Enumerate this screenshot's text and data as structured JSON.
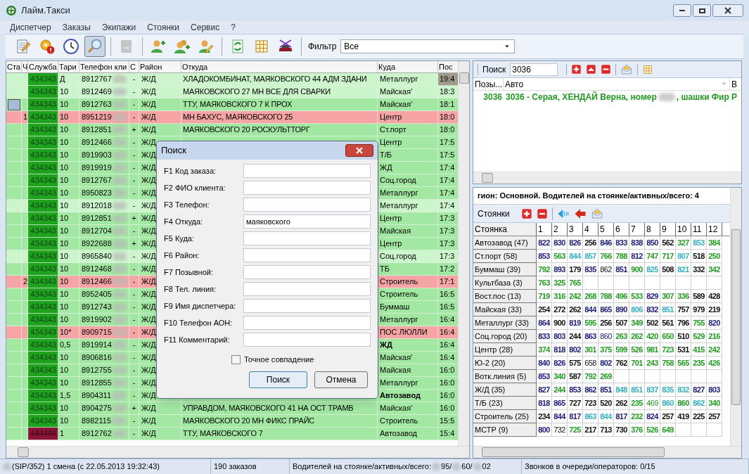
{
  "window": {
    "title": "Лайм.Такси"
  },
  "menu": [
    "Диспетчер",
    "Заказы",
    "Экипажи",
    "Стоянки",
    "Сервис",
    "?"
  ],
  "toolbar": {
    "buttons": [
      {
        "pressed": false,
        "disabled": false
      },
      {
        "pressed": false,
        "disabled": false
      },
      {
        "pressed": false,
        "disabled": false
      },
      {
        "pressed": true,
        "disabled": false
      },
      {
        "pressed": false,
        "disabled": true
      },
      {
        "pressed": false,
        "disabled": false
      },
      {
        "pressed": false,
        "disabled": false
      },
      {
        "pressed": false,
        "disabled": false
      },
      {
        "pressed": false,
        "disabled": false
      },
      {
        "pressed": false,
        "disabled": false
      },
      {
        "pressed": false,
        "disabled": false
      }
    ],
    "filter_label": "Фильтр",
    "filter_value": "Все"
  },
  "orders": {
    "columns": [
      "Ста",
      "Ч",
      "Служба",
      "Тари",
      "Телефон кли",
      "С",
      "Район",
      "Откуда",
      "Куда",
      "Пос"
    ],
    "rows": [
      {
        "kind": "light",
        "selected": true,
        "flagged": false,
        "service": "434343",
        "color": "#1fa31f",
        "tariff": "Д",
        "phone": "8912767",
        "sign": "-",
        "district": "Ж/Д",
        "from": "ХЛАДОКОМБИНАТ, МАЯКОВСКОГО 44  АДМ ЗДАНИ",
        "to": "Металлург",
        "to_bold": false,
        "time": "19:4"
      },
      {
        "kind": "light",
        "selected": false,
        "flagged": false,
        "service": "434343",
        "color": "#1fa31f",
        "tariff": "10",
        "phone": "8912469",
        "sign": "-",
        "district": "Ж/Д",
        "from": "МАЯКОВСКОГО 27  МН ВСЕ ДЛЯ СВАРКИ",
        "to": "Майская'",
        "to_bold": false,
        "time": "18:3"
      },
      {
        "kind": "normal",
        "selected": false,
        "flagged": true,
        "service": "434343",
        "color": "#1fa31f",
        "tariff": "10",
        "phone": "8912763",
        "sign": "-",
        "district": "Ж/Д",
        "from": "ТТУ, МАЯКОВСКОГО 7  К ПРОХ",
        "to": "Майская'",
        "to_bold": false,
        "time": "18:1"
      },
      {
        "kind": "alert",
        "selected": false,
        "flagged": false,
        "count": "1",
        "service": "434343",
        "color": "#1fa31f",
        "tariff": "10",
        "phone": "8951219",
        "sign": "-",
        "district": "Ж/Д",
        "from": "МН БАХУС, МАЯКОВСКОГО 25",
        "to": "Центр",
        "to_bold": false,
        "time": "18:0"
      },
      {
        "kind": "normal",
        "selected": false,
        "flagged": false,
        "service": "434343",
        "color": "#1fa31f",
        "tariff": "10",
        "phone": "8912851",
        "sign": "+",
        "district": "Ж/Д",
        "from": "МАЯКОВСКОГО 20 РОСКУЛЬТТОРГ",
        "to": "Ст.порт",
        "to_bold": false,
        "time": "18:0"
      },
      {
        "kind": "normal",
        "selected": false,
        "flagged": false,
        "service": "434343",
        "color": "#1fa31f",
        "tariff": "10",
        "phone": "8912466",
        "sign": "-",
        "district": "Ж/Д",
        "to": "Центр",
        "to_bold": false,
        "time": "17:5"
      },
      {
        "kind": "normal",
        "selected": false,
        "flagged": false,
        "service": "434343",
        "color": "#1fa31f",
        "tariff": "10",
        "phone": "8919903",
        "sign": "-",
        "district": "Ж/Д",
        "to": "Т/Б",
        "to_bold": false,
        "time": "17:5"
      },
      {
        "kind": "normal",
        "selected": false,
        "flagged": false,
        "service": "434343",
        "color": "#1fa31f",
        "tariff": "10",
        "phone": "8919919",
        "sign": "-",
        "district": "Ж/Д",
        "to": "ЖД",
        "to_bold": false,
        "time": "17:4"
      },
      {
        "kind": "normal",
        "selected": false,
        "flagged": false,
        "service": "434343",
        "color": "#1fa31f",
        "tariff": "10",
        "phone": "8912767",
        "sign": "-",
        "district": "Ж/Д",
        "to": "Соц.город",
        "to_bold": false,
        "time": "17:4"
      },
      {
        "kind": "normal",
        "selected": false,
        "flagged": false,
        "service": "434343",
        "color": "#1fa31f",
        "tariff": "10",
        "phone": "8950823",
        "sign": "-",
        "district": "Ж/Д",
        "to": "Металлург",
        "to_bold": false,
        "time": "17:4"
      },
      {
        "kind": "light",
        "selected": false,
        "flagged": false,
        "service": "434343",
        "color": "#1fa31f",
        "tariff": "10",
        "phone": "8912018",
        "sign": "-",
        "district": "Ж/Д",
        "to": "Металлург",
        "to_bold": false,
        "time": "17:4"
      },
      {
        "kind": "normal",
        "selected": false,
        "flagged": false,
        "service": "434343",
        "color": "#1fa31f",
        "tariff": "10",
        "phone": "8912851",
        "sign": "+",
        "district": "Ж/Д",
        "to": "Центр",
        "to_bold": false,
        "time": "17:3"
      },
      {
        "kind": "normal",
        "selected": false,
        "flagged": false,
        "service": "434343",
        "color": "#1fa31f",
        "tariff": "10",
        "phone": "8912704",
        "sign": "-",
        "district": "Ж/Д",
        "to": "Майская",
        "to_bold": false,
        "time": "17:3"
      },
      {
        "kind": "normal",
        "selected": false,
        "flagged": false,
        "service": "434343",
        "color": "#1fa31f",
        "tariff": "10",
        "phone": "8922688",
        "sign": "+",
        "district": "Ж/Д",
        "to": "Центр",
        "to_bold": false,
        "time": "17:3"
      },
      {
        "kind": "light",
        "selected": false,
        "flagged": false,
        "service": "434343",
        "color": "#1fa31f",
        "tariff": "10",
        "phone": "8965840",
        "sign": "-",
        "district": "Ж/Д",
        "to": "Соц.город",
        "to_bold": false,
        "time": "17:3"
      },
      {
        "kind": "normal",
        "selected": false,
        "flagged": false,
        "service": "434343",
        "color": "#1fa31f",
        "tariff": "10",
        "phone": "8912468",
        "sign": "-",
        "district": "Ж/Д",
        "to": "ТБ",
        "to_bold": false,
        "time": "17:2"
      },
      {
        "kind": "alert",
        "selected": false,
        "flagged": false,
        "count": "2",
        "service": "434343",
        "color": "#1fa31f",
        "tariff": "10",
        "phone": "8912466",
        "sign": "-",
        "district": "Ж/Д",
        "to": "Строитель",
        "to_bold": false,
        "time": "17:1"
      },
      {
        "kind": "normal",
        "selected": false,
        "flagged": false,
        "service": "434343",
        "color": "#1fa31f",
        "tariff": "10",
        "phone": "8952405",
        "sign": "-",
        "district": "Ж/Д",
        "to": "Строитель",
        "to_bold": false,
        "time": "16:5"
      },
      {
        "kind": "normal",
        "selected": false,
        "flagged": false,
        "service": "434343",
        "color": "#1fa31f",
        "tariff": "10",
        "phone": "8912743",
        "sign": "-",
        "district": "Ж/Д",
        "to": "Буммаш",
        "to_bold": false,
        "time": "16:5"
      },
      {
        "kind": "normal",
        "selected": false,
        "flagged": false,
        "service": "434343",
        "color": "#1fa31f",
        "tariff": "10",
        "phone": "8919902",
        "sign": "-",
        "district": "Ж/Д",
        "to": "Металлург",
        "to_bold": false,
        "time": "16:4"
      },
      {
        "kind": "alert",
        "selected": false,
        "flagged": false,
        "service": "434343",
        "color": "#1fa31f",
        "tariff": "10*",
        "phone": "8909715",
        "sign": "-",
        "district": "Ж/Д",
        "to": "ПОС ЛЮЛЛИ",
        "to_bold": false,
        "time": "16:4"
      },
      {
        "kind": "normal",
        "selected": false,
        "flagged": false,
        "service": "434343",
        "color": "#1fa31f",
        "tariff": "0,5",
        "phone": "8919914",
        "sign": "-",
        "district": "Ж/Д",
        "to": "ЖД",
        "to_bold": true,
        "time": "16:4"
      },
      {
        "kind": "normal",
        "selected": false,
        "flagged": false,
        "service": "434343",
        "color": "#1fa31f",
        "tariff": "10",
        "phone": "8906816",
        "sign": "-",
        "district": "Ж/Д",
        "to": "Майская'",
        "to_bold": false,
        "time": "16:4"
      },
      {
        "kind": "normal",
        "selected": false,
        "flagged": false,
        "service": "434343",
        "color": "#1fa31f",
        "tariff": "10",
        "phone": "8912755",
        "sign": "-",
        "district": "Ж/Д",
        "to": "Майская",
        "to_bold": false,
        "time": "16:0"
      },
      {
        "kind": "normal",
        "selected": false,
        "flagged": false,
        "service": "434343",
        "color": "#1fa31f",
        "tariff": "10",
        "phone": "8912855",
        "sign": "-",
        "district": "Ж/Д",
        "to": "Металлург",
        "to_bold": false,
        "time": "16:0"
      },
      {
        "kind": "normal",
        "selected": false,
        "flagged": false,
        "service": "434343",
        "color": "#1fa31f",
        "tariff": "1,5",
        "phone": "8904311",
        "sign": "-",
        "district": "Ж/Д",
        "to": "Автозавод",
        "to_bold": true,
        "time": "16:0"
      },
      {
        "kind": "normal",
        "selected": false,
        "flagged": false,
        "service": "434343",
        "color": "#1fa31f",
        "tariff": "10",
        "phone": "8904275",
        "sign": "+",
        "district": "Ж/Д",
        "from": "УПРАВДОМ, МАЯКОВСКОГО 41 НА ОСТ ТРАМВ",
        "to": "Майская'",
        "to_bold": false,
        "time": "16:0"
      },
      {
        "kind": "normal",
        "selected": false,
        "flagged": false,
        "service": "434343",
        "color": "#1fa31f",
        "tariff": "10",
        "phone": "8982115",
        "sign": "-",
        "district": "Ж/Д",
        "from": "МАЯКОВСКОГО 20 МН ФИКС ПРАЙС",
        "to": "Строитель",
        "to_bold": false,
        "time": "15:5"
      },
      {
        "kind": "normal",
        "selected": false,
        "flagged": false,
        "service": "444444",
        "color": "#8a1539",
        "tariff": "1",
        "phone": "8912762",
        "sign": "-",
        "district": "Ж/Д",
        "from": "ТТУ, МАЯКОВСКОГО 7",
        "to": "Автозавод",
        "to_bold": false,
        "time": "15:4"
      }
    ]
  },
  "crew_search": {
    "label": "Поиск",
    "value": "3036",
    "columns": [
      "Позы...",
      "Авто",
      "В"
    ],
    "rows": [
      {
        "callsign": "3036",
        "auto_before": "3036 - Серая, ХЕНДАЙ Верна, номер",
        "auto_after": ", шашки Фир",
        "column_3": "Р"
      }
    ]
  },
  "stops": {
    "header": "гион: Основной. Водителей на стоянке/активных/всего: 4",
    "toolbar_label": "Стоянки",
    "corner": "Стоянка",
    "columns": [
      "1",
      "2",
      "3",
      "4",
      "5",
      "6",
      "7",
      "8",
      "9",
      "10",
      "11",
      "12"
    ],
    "rows": [
      {
        "name": "Автозавод (47)",
        "cells": [
          {
            "text": "822",
            "color": "#1c1c78",
            "bold": true
          },
          {
            "text": "830",
            "color": "#1c1c78",
            "bold": true
          },
          {
            "text": "826",
            "color": "#1c1c78",
            "bold": true
          },
          {
            "text": "256",
            "color": "#111111",
            "bold": true
          },
          {
            "text": "846",
            "color": "#1c1c78",
            "bold": true
          },
          {
            "text": "833",
            "color": "#1c1c78",
            "bold": true
          },
          {
            "text": "838",
            "color": "#1c1c78",
            "bold": true
          },
          {
            "text": "850",
            "color": "#1c1c78",
            "bold": true
          },
          {
            "text": "562",
            "color": "#111111",
            "bold": true
          },
          {
            "text": "327",
            "color": "#239a23",
            "bold": true
          },
          {
            "text": "853",
            "color": "#38b0c0",
            "bold": true
          },
          {
            "text": "384",
            "color": "#239a23",
            "bold": true
          }
        ]
      },
      {
        "name": "Ст.порт (58)",
        "cells": [
          {
            "text": "853",
            "color": "#1c1c78",
            "bold": true
          },
          {
            "text": "563",
            "color": "#239a23",
            "bold": true
          },
          {
            "text": "844",
            "color": "#38b0c0",
            "bold": true
          },
          {
            "text": "857",
            "color": "#38b0c0",
            "bold": true
          },
          {
            "text": "766",
            "color": "#239a23",
            "bold": true
          },
          {
            "text": "788",
            "color": "#239a23",
            "bold": true
          },
          {
            "text": "812",
            "color": "#1c1c78",
            "bold": true
          },
          {
            "text": "747",
            "color": "#239a23",
            "bold": true
          },
          {
            "text": "717",
            "color": "#239a23",
            "bold": true
          },
          {
            "text": "807",
            "color": "#38b0c0",
            "bold": true
          },
          {
            "text": "518",
            "color": "#111111",
            "bold": true
          },
          {
            "text": "250",
            "color": "#239a23",
            "bold": true
          }
        ]
      },
      {
        "name": "Буммаш (39)",
        "cells": [
          {
            "text": "792",
            "color": "#239a23",
            "bold": true
          },
          {
            "text": "893",
            "color": "#1c1c78",
            "bold": true
          },
          {
            "text": "179",
            "color": "#111111",
            "bold": true
          },
          {
            "text": "835",
            "color": "#1c1c78",
            "bold": true
          },
          {
            "text": "862",
            "color": "#111111",
            "bold": false
          },
          {
            "text": "851",
            "color": "#1c1c78",
            "bold": true
          },
          {
            "text": "900",
            "color": "#239a23",
            "bold": true
          },
          {
            "text": "825",
            "color": "#38b0c0",
            "bold": true
          },
          {
            "text": "508",
            "color": "#111111",
            "bold": true
          },
          {
            "text": "821",
            "color": "#38b0c0",
            "bold": true
          },
          {
            "text": "332",
            "color": "#111111",
            "bold": true
          },
          {
            "text": "342",
            "color": "#239a23",
            "bold": true
          }
        ]
      },
      {
        "name": "Культбаза (3)",
        "cells": [
          {
            "text": "763",
            "color": "#239a23",
            "bold": true
          },
          {
            "text": "325",
            "color": "#239a23",
            "bold": true
          },
          {
            "text": "765",
            "color": "#239a23",
            "bold": true
          }
        ]
      },
      {
        "name": "Вост.пос (13)",
        "cells": [
          {
            "text": "719",
            "color": "#239a23",
            "bold": true
          },
          {
            "text": "316",
            "color": "#239a23",
            "bold": true
          },
          {
            "text": "242",
            "color": "#239a23",
            "bold": true
          },
          {
            "text": "268",
            "color": "#239a23",
            "bold": true
          },
          {
            "text": "788",
            "color": "#239a23",
            "bold": true
          },
          {
            "text": "496",
            "color": "#239a23",
            "bold": true
          },
          {
            "text": "533",
            "color": "#239a23",
            "bold": true
          },
          {
            "text": "829",
            "color": "#1c1c78",
            "bold": true
          },
          {
            "text": "307",
            "color": "#239a23",
            "bold": true
          },
          {
            "text": "336",
            "color": "#239a23",
            "bold": true
          },
          {
            "text": "589",
            "color": "#111111",
            "bold": true
          },
          {
            "text": "428",
            "color": "#111111",
            "bold": true
          }
        ]
      },
      {
        "name": "Майская (33)",
        "cells": [
          {
            "text": "254",
            "color": "#111111",
            "bold": true
          },
          {
            "text": "272",
            "color": "#111111",
            "bold": true
          },
          {
            "text": "262",
            "color": "#111111",
            "bold": true
          },
          {
            "text": "844",
            "color": "#1c1c78",
            "bold": true
          },
          {
            "text": "865",
            "color": "#1c1c78",
            "bold": true
          },
          {
            "text": "890",
            "color": "#1c1c78",
            "bold": true
          },
          {
            "text": "806",
            "color": "#38b0c0",
            "bold": true
          },
          {
            "text": "832",
            "color": "#1c1c78",
            "bold": true
          },
          {
            "text": "851",
            "color": "#38b0c0",
            "bold": true
          },
          {
            "text": "757",
            "color": "#111111",
            "bold": true
          },
          {
            "text": "979",
            "color": "#111111",
            "bold": true
          },
          {
            "text": "219",
            "color": "#111111",
            "bold": true
          }
        ]
      },
      {
        "name": "Металлург (33)",
        "cells": [
          {
            "text": "864",
            "color": "#1c1c78",
            "bold": true
          },
          {
            "text": "900",
            "color": "#111111",
            "bold": true
          },
          {
            "text": "819",
            "color": "#1c1c78",
            "bold": true
          },
          {
            "text": "595",
            "color": "#239a23",
            "bold": true
          },
          {
            "text": "256",
            "color": "#111111",
            "bold": true
          },
          {
            "text": "507",
            "color": "#111111",
            "bold": true
          },
          {
            "text": "349",
            "color": "#239a23",
            "bold": true
          },
          {
            "text": "502",
            "color": "#111111",
            "bold": true
          },
          {
            "text": "561",
            "color": "#111111",
            "bold": true
          },
          {
            "text": "796",
            "color": "#111111",
            "bold": true
          },
          {
            "text": "755",
            "color": "#239a23",
            "bold": true
          },
          {
            "text": "820",
            "color": "#1c1c78",
            "bold": true
          }
        ]
      },
      {
        "name": "Соц.город (20)",
        "cells": [
          {
            "text": "833",
            "color": "#1c1c78",
            "bold": true
          },
          {
            "text": "803",
            "color": "#1c1c78",
            "bold": true
          },
          {
            "text": "244",
            "color": "#111111",
            "bold": true
          },
          {
            "text": "863",
            "color": "#1c1c78",
            "bold": true
          },
          {
            "text": "860",
            "color": "#1c1c78",
            "bold": false
          },
          {
            "text": "263",
            "color": "#239a23",
            "bold": true
          },
          {
            "text": "262",
            "color": "#239a23",
            "bold": true
          },
          {
            "text": "420",
            "color": "#239a23",
            "bold": true
          },
          {
            "text": "650",
            "color": "#239a23",
            "bold": true
          },
          {
            "text": "510",
            "color": "#111111",
            "bold": true
          },
          {
            "text": "529",
            "color": "#239a23",
            "bold": true
          },
          {
            "text": "216",
            "color": "#239a23",
            "bold": true
          }
        ]
      },
      {
        "name": "Центр (28)",
        "cells": [
          {
            "text": "374",
            "color": "#239a23",
            "bold": true
          },
          {
            "text": "818",
            "color": "#1c1c78",
            "bold": true
          },
          {
            "text": "802",
            "color": "#1c1c78",
            "bold": true
          },
          {
            "text": "301",
            "color": "#239a23",
            "bold": true
          },
          {
            "text": "375",
            "color": "#239a23",
            "bold": true
          },
          {
            "text": "599",
            "color": "#239a23",
            "bold": true
          },
          {
            "text": "526",
            "color": "#239a23",
            "bold": true
          },
          {
            "text": "981",
            "color": "#239a23",
            "bold": true
          },
          {
            "text": "723",
            "color": "#239a23",
            "bold": true
          },
          {
            "text": "531",
            "color": "#111111",
            "bold": true
          },
          {
            "text": "415",
            "color": "#239a23",
            "bold": true
          },
          {
            "text": "242",
            "color": "#239a23",
            "bold": true
          }
        ]
      },
      {
        "name": "Ю-2 (20)",
        "cells": [
          {
            "text": "840",
            "color": "#1c1c78",
            "bold": true
          },
          {
            "text": "826",
            "color": "#1c1c78",
            "bold": true
          },
          {
            "text": "575",
            "color": "#111111",
            "bold": true
          },
          {
            "text": "658",
            "color": "#111111",
            "bold": false
          },
          {
            "text": "802",
            "color": "#1c1c78",
            "bold": true
          },
          {
            "text": "762",
            "color": "#111111",
            "bold": true
          },
          {
            "text": "701",
            "color": "#239a23",
            "bold": true
          },
          {
            "text": "243",
            "color": "#239a23",
            "bold": true
          },
          {
            "text": "758",
            "color": "#239a23",
            "bold": true
          },
          {
            "text": "565",
            "color": "#239a23",
            "bold": true
          },
          {
            "text": "235",
            "color": "#239a23",
            "bold": true
          },
          {
            "text": "426",
            "color": "#239a23",
            "bold": true
          }
        ]
      },
      {
        "name": "Вотк.линия (5)",
        "cells": [
          {
            "text": "853",
            "color": "#1c1c78",
            "bold": true
          },
          {
            "text": "340",
            "color": "#239a23",
            "bold": true
          },
          {
            "text": "587",
            "color": "#111111",
            "bold": true
          },
          {
            "text": "792",
            "color": "#239a23",
            "bold": true
          },
          {
            "text": "269",
            "color": "#239a23",
            "bold": true
          }
        ]
      },
      {
        "name": "Ж/Д (35)",
        "cells": [
          {
            "text": "827",
            "color": "#1c1c78",
            "bold": true
          },
          {
            "text": "244",
            "color": "#239a23",
            "bold": true
          },
          {
            "text": "853",
            "color": "#1c1c78",
            "bold": true
          },
          {
            "text": "862",
            "color": "#1c1c78",
            "bold": true
          },
          {
            "text": "851",
            "color": "#1c1c78",
            "bold": true
          },
          {
            "text": "848",
            "color": "#38b0c0",
            "bold": true
          },
          {
            "text": "851",
            "color": "#38b0c0",
            "bold": true
          },
          {
            "text": "837",
            "color": "#38b0c0",
            "bold": true
          },
          {
            "text": "835",
            "color": "#38b0c0",
            "bold": true
          },
          {
            "text": "832",
            "color": "#38b0c0",
            "bold": true
          },
          {
            "text": "827",
            "color": "#1c1c78",
            "bold": true
          },
          {
            "text": "803",
            "color": "#1c1c78",
            "bold": true
          }
        ]
      },
      {
        "name": "Т/Б (23)",
        "cells": [
          {
            "text": "818",
            "color": "#1c1c78",
            "bold": true
          },
          {
            "text": "865",
            "color": "#1c1c78",
            "bold": true
          },
          {
            "text": "727",
            "color": "#111111",
            "bold": true
          },
          {
            "text": "723",
            "color": "#111111",
            "bold": true
          },
          {
            "text": "520",
            "color": "#111111",
            "bold": true
          },
          {
            "text": "262",
            "color": "#111111",
            "bold": true
          },
          {
            "text": "235",
            "color": "#239a23",
            "bold": true
          },
          {
            "text": "469",
            "color": "#239a23",
            "bold": false
          },
          {
            "text": "860",
            "color": "#38b0c0",
            "bold": true
          },
          {
            "text": "860",
            "color": "#239a23",
            "bold": true
          },
          {
            "text": "862",
            "color": "#38b0c0",
            "bold": true
          },
          {
            "text": "340",
            "color": "#239a23",
            "bold": true
          }
        ]
      },
      {
        "name": "Строитель (25)",
        "cells": [
          {
            "text": "234",
            "color": "#111111",
            "bold": true
          },
          {
            "text": "844",
            "color": "#1c1c78",
            "bold": true
          },
          {
            "text": "817",
            "color": "#1c1c78",
            "bold": true
          },
          {
            "text": "863",
            "color": "#38b0c0",
            "bold": true
          },
          {
            "text": "844",
            "color": "#38b0c0",
            "bold": true
          },
          {
            "text": "817",
            "color": "#1c1c78",
            "bold": true
          },
          {
            "text": "232",
            "color": "#239a23",
            "bold": true
          },
          {
            "text": "824",
            "color": "#1c1c78",
            "bold": true
          },
          {
            "text": "257",
            "color": "#111111",
            "bold": true
          },
          {
            "text": "419",
            "color": "#111111",
            "bold": true
          },
          {
            "text": "225",
            "color": "#111111",
            "bold": true
          },
          {
            "text": "257",
            "color": "#111111",
            "bold": true
          }
        ]
      },
      {
        "name": "МСТР (9)",
        "cells": [
          {
            "text": "800",
            "color": "#1c1c78",
            "bold": true
          },
          {
            "text": "732",
            "color": "#111111",
            "bold": false
          },
          {
            "text": "725",
            "color": "#239a23",
            "bold": true
          },
          {
            "text": "217",
            "color": "#111111",
            "bold": true
          },
          {
            "text": "713",
            "color": "#111111",
            "bold": true
          },
          {
            "text": "730",
            "color": "#111111",
            "bold": true
          },
          {
            "text": "376",
            "color": "#239a23",
            "bold": true
          },
          {
            "text": "526",
            "color": "#239a23",
            "bold": true
          },
          {
            "text": "649",
            "color": "#239a23",
            "bold": true
          }
        ]
      }
    ]
  },
  "dialog": {
    "title": "Поиск",
    "fields": [
      {
        "label": "F1 Код заказа:"
      },
      {
        "label": "F2 ФИО клиента:"
      },
      {
        "label": "F3 Телефон:"
      },
      {
        "label": "F4 Откуда:",
        "value": "маяковского"
      },
      {
        "label": "F5 Куда:"
      },
      {
        "label": "F6 Район:"
      },
      {
        "label": "F7 Позывной:"
      },
      {
        "label": "F8 Тел. линия:"
      },
      {
        "label": "F9 Имя диспетчера:"
      },
      {
        "label": "F10 Телефон АОН:"
      },
      {
        "label": "F11 Комментарий:"
      }
    ],
    "exact_match": {
      "label": "Точное совпадение",
      "checked": false
    },
    "ok": "Поиск",
    "cancel": "Отмена"
  },
  "status_bar": [
    {
      "parts": [
        {
          "text": "(SIP/352) 1 смена (с 22.05.2013 19:32:43)",
          "blur_before": true
        }
      ]
    },
    {
      "parts": [
        {
          "text": "190 заказов",
          "blur_before": false
        }
      ]
    },
    {
      "parts": [
        {
          "text": "Водителей на стоянке/активных/всего:",
          "blur_before": false
        },
        {
          "text": "95/",
          "blur_before": true
        },
        {
          "text": "60/",
          "blur_before": true
        },
        {
          "text": "02",
          "blur_before": true
        }
      ]
    },
    {
      "parts": [
        {
          "text": "Звонков в очереди/операторов: 0/15",
          "blur_before": false
        }
      ]
    }
  ]
}
